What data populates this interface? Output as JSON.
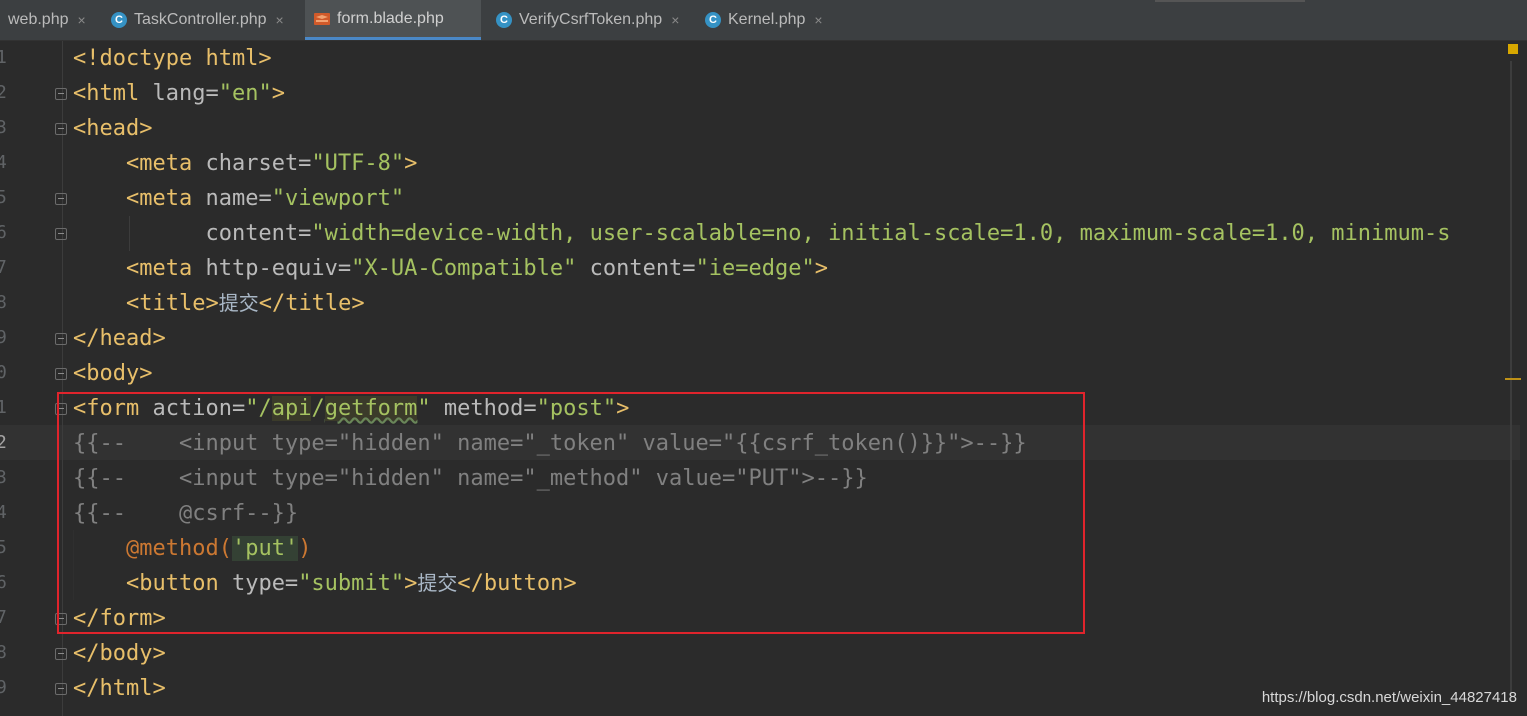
{
  "tabs": [
    {
      "label": "web.php",
      "icon": "php-file-icon",
      "active": false
    },
    {
      "label": "TaskController.php",
      "icon": "class-icon",
      "active": false
    },
    {
      "label": "form.blade.php",
      "icon": "blade-file-icon",
      "active": true
    },
    {
      "label": "VerifyCsrfToken.php",
      "icon": "class-icon",
      "active": false
    },
    {
      "label": "Kernel.php",
      "icon": "class-icon",
      "active": false
    }
  ],
  "tab_close_glyph": "×",
  "class_icon_letter": "C",
  "gutter": {
    "line_numbers": [
      "1",
      "2",
      "3",
      "4",
      "5",
      "6",
      "7",
      "8",
      "9",
      "0",
      "1",
      "2",
      "3",
      "4",
      "5",
      "6",
      "7",
      "8",
      "9"
    ],
    "current_line_index": 11
  },
  "code": {
    "l1": {
      "a": "<!doctype html>"
    },
    "l2": {
      "a": "<html ",
      "b": "lang=",
      "c": "\"en\"",
      "d": ">"
    },
    "l3": {
      "a": "<head>"
    },
    "l4": {
      "a": "<meta ",
      "b": "charset=",
      "c": "\"UTF-8\"",
      "d": ">"
    },
    "l5": {
      "a": "<meta ",
      "b": "name=",
      "c": "\"viewport\""
    },
    "l6": {
      "b": "content=",
      "c": "\"width=device-width, user-scalable=no, initial-scale=1.0, maximum-scale=1.0, minimum-s"
    },
    "l7": {
      "a": "<meta ",
      "b": "http-equiv=",
      "c": "\"X-UA-Compatible\"",
      "b2": " content=",
      "c2": "\"ie=edge\"",
      "d": ">"
    },
    "l8": {
      "a": "<title>",
      "t": "提交",
      "d": "</title>"
    },
    "l9": {
      "a": "</head>"
    },
    "l10": {
      "a": "<body>"
    },
    "l11": {
      "a": "<form ",
      "b": "action=",
      "c1": "\"/",
      "c2": "api",
      "c3": "/",
      "c4": "getform",
      "c5": "\"",
      "b2": " method=",
      "c6": "\"post\"",
      "d": ">"
    },
    "l12": {
      "text": "{{--    <input type=\"hidden\" name=\"_token\" value=\"{{csrf_token()}}\">--}}"
    },
    "l13": {
      "text": "{{--    <input type=\"hidden\" name=\"_method\" value=\"PUT\">--}}"
    },
    "l14": {
      "text": "{{--    @csrf--}}"
    },
    "l15": {
      "a": "@method",
      "p1": "(",
      "c": "'put'",
      "p2": ")"
    },
    "l16": {
      "a": "<button ",
      "b": "type=",
      "c": "\"submit\"",
      "d": ">",
      "t": "提交",
      "e": "</button>"
    },
    "l17": {
      "a": "</form>"
    },
    "l18": {
      "a": "</body>"
    },
    "l19": {
      "a": "</html>"
    }
  },
  "watermark": "https://blog.csdn.net/weixin_44827418",
  "colors": {
    "background": "#2b2b2b",
    "tag": "#e8bf6a",
    "string": "#a5c261",
    "comment": "#808080",
    "directive": "#cc7832",
    "highlight_box": "#e0242c"
  }
}
